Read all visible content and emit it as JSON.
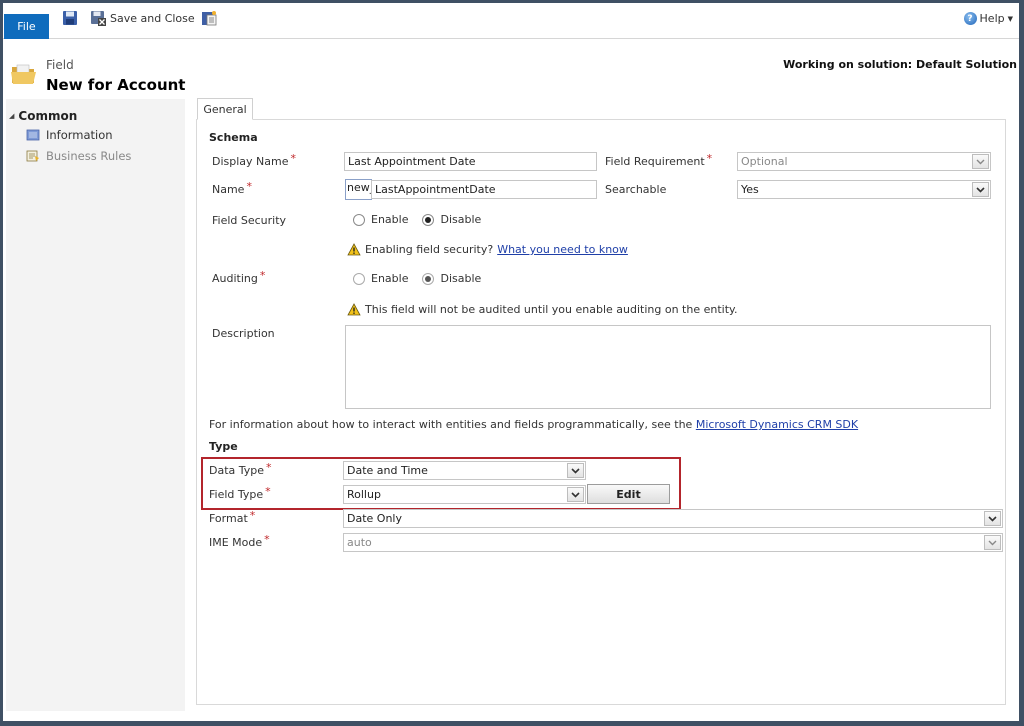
{
  "toolbar": {
    "file_label": "File",
    "save_icon": "save-icon",
    "save_close_label": "Save and Close",
    "save_close_icon": "save-and-close-icon",
    "publish_icon": "publish-icon",
    "help_label": "Help",
    "help_icon": "help-icon"
  },
  "header": {
    "entity_label": "Field",
    "title": "New for Account",
    "solution_text": "Working on solution: Default Solution",
    "icon": "folder-icon"
  },
  "sidebar": {
    "group_label": "Common",
    "items": [
      {
        "label": "Information",
        "icon": "information-icon",
        "active": true
      },
      {
        "label": "Business Rules",
        "icon": "business-rules-icon",
        "active": false
      }
    ]
  },
  "tabs": [
    {
      "label": "General",
      "selected": true
    }
  ],
  "schema": {
    "section_title": "Schema",
    "display_name": {
      "label": "Display Name",
      "required": "*",
      "value": "Last Appointment Date"
    },
    "name": {
      "label": "Name",
      "required": "*",
      "prefix": "new_",
      "value": "LastAppointmentDate"
    },
    "field_requirement": {
      "label": "Field Requirement",
      "required": "*",
      "value": "Optional",
      "disabled": true
    },
    "searchable": {
      "label": "Searchable",
      "value": "Yes"
    },
    "field_security": {
      "label": "Field Security",
      "options": [
        "Enable",
        "Disable"
      ],
      "selected": "Disable",
      "warning": "Enabling field security?",
      "warning_link": "What you need to know"
    },
    "auditing": {
      "label": "Auditing",
      "required": "*",
      "options": [
        "Enable",
        "Disable"
      ],
      "selected": "Disable",
      "disabled": true,
      "warning": "This field will not be audited until you enable auditing on the entity."
    },
    "description": {
      "label": "Description",
      "value": ""
    },
    "sdk_text": "For information about how to interact with entities and fields programmatically, see the",
    "sdk_link": "Microsoft Dynamics CRM SDK"
  },
  "type": {
    "section_title": "Type",
    "data_type": {
      "label": "Data Type",
      "required": "*",
      "value": "Date and Time"
    },
    "field_type": {
      "label": "Field Type",
      "required": "*",
      "value": "Rollup"
    },
    "edit_label": "Edit",
    "format": {
      "label": "Format",
      "required": "*",
      "value": "Date Only"
    },
    "ime_mode": {
      "label": "IME Mode",
      "required": "*",
      "value": "auto",
      "disabled": true
    }
  },
  "colors": {
    "file_button": "#0f6cbd",
    "highlight_border": "#b3252c",
    "required_marker": "#c0282b",
    "link": "#1f3fa8"
  }
}
